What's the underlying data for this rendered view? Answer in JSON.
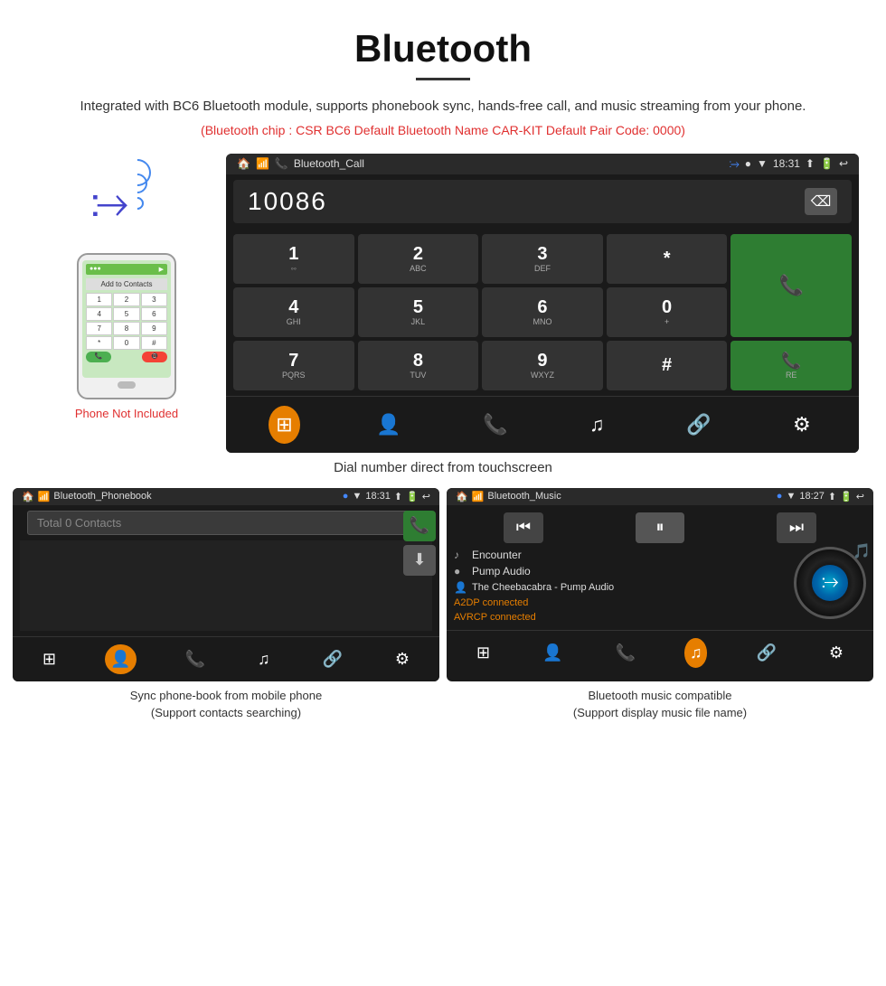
{
  "page": {
    "title": "Bluetooth",
    "subtitle": "Integrated with BC6 Bluetooth module, supports phonebook sync, hands-free call, and music streaming from your phone.",
    "specs": "(Bluetooth chip : CSR BC6    Default Bluetooth Name CAR-KIT    Default Pair Code: 0000)",
    "phone_not_included": "Phone Not Included",
    "main_caption": "Dial number direct from touchscreen",
    "phonebook_caption": "Sync phone-book from mobile phone\n(Support contacts searching)",
    "music_caption": "Bluetooth music compatible\n(Support display music file name)"
  },
  "statusbar_dial": {
    "label": "Bluetooth_Call",
    "time": "18:31",
    "icons": "⬆"
  },
  "dial": {
    "number": "10086",
    "backspace": "⌫",
    "keys": [
      {
        "main": "1",
        "sub": "◦◦"
      },
      {
        "main": "2",
        "sub": "ABC"
      },
      {
        "main": "3",
        "sub": "DEF"
      },
      {
        "main": "*",
        "sub": ""
      },
      {
        "main": "📞",
        "sub": "",
        "type": "call"
      },
      {
        "main": "4",
        "sub": "GHI"
      },
      {
        "main": "5",
        "sub": "JKL"
      },
      {
        "main": "6",
        "sub": "MNO"
      },
      {
        "main": "0",
        "sub": "+"
      },
      {
        "main": "",
        "sub": ""
      },
      {
        "main": "7",
        "sub": "PQRS"
      },
      {
        "main": "8",
        "sub": "TUV"
      },
      {
        "main": "9",
        "sub": "WXYZ"
      },
      {
        "main": "#",
        "sub": ""
      },
      {
        "main": "📞",
        "sub": "RE",
        "type": "recall"
      }
    ],
    "bottom_icons": [
      "⊞",
      "👤",
      "📞",
      "♫",
      "🔗",
      "⚙"
    ]
  },
  "phonebook": {
    "statusbar_label": "Bluetooth_Phonebook",
    "statusbar_time": "18:31",
    "search_placeholder": "Total 0 Contacts",
    "bottom_icons": [
      "⊞",
      "👤",
      "📞",
      "♫",
      "🔗",
      "⚙"
    ]
  },
  "music": {
    "statusbar_label": "Bluetooth_Music",
    "statusbar_time": "18:27",
    "track": "Encounter",
    "album": "Pump Audio",
    "artist": "The Cheebacabra - Pump Audio",
    "status1": "A2DP connected",
    "status2": "AVRCP connected",
    "bottom_icons": [
      "⊞",
      "👤",
      "📞",
      "♫",
      "🔗",
      "⚙"
    ]
  }
}
